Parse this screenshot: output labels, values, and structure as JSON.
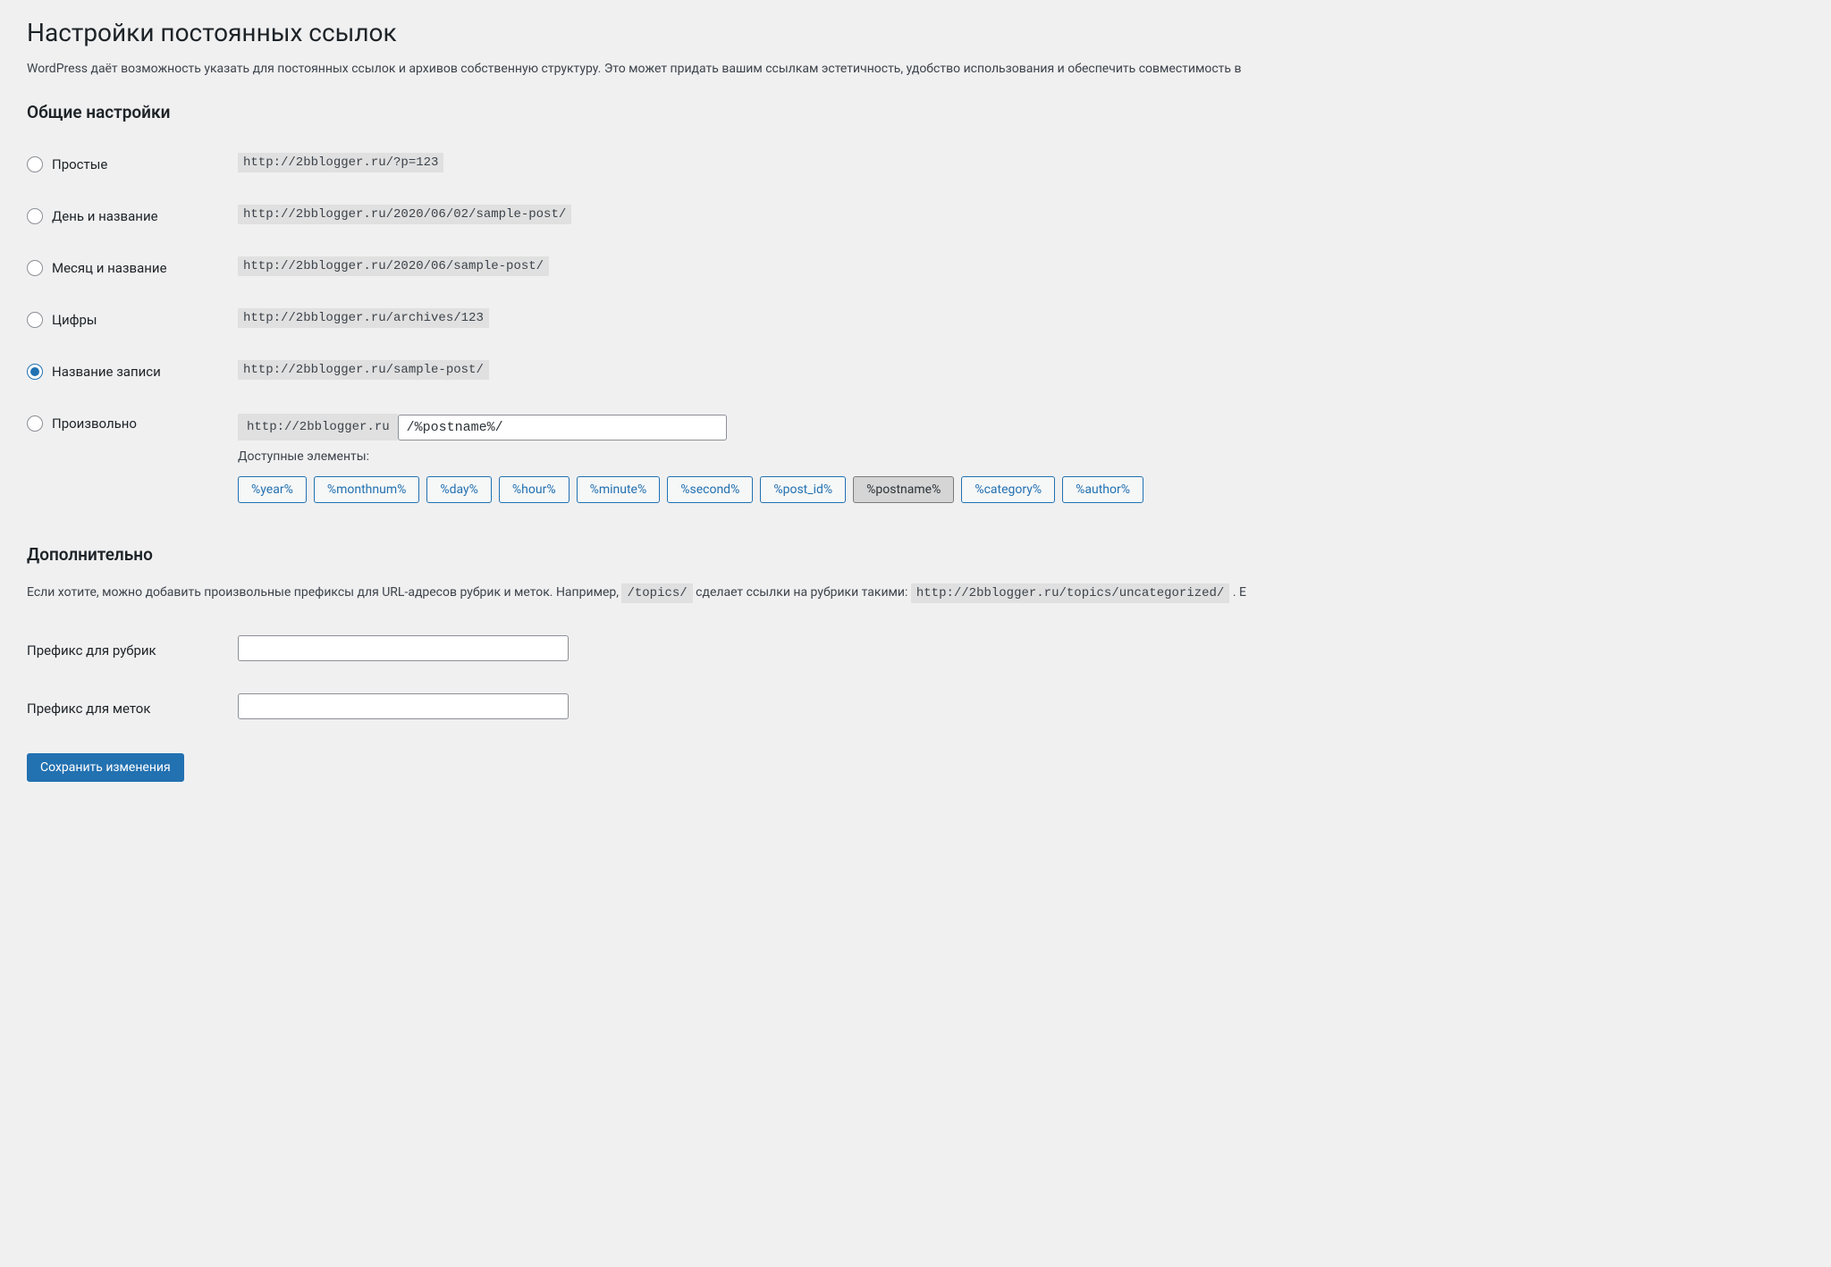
{
  "page_title": "Настройки постоянных ссылок",
  "description": "WordPress даёт возможность указать для постоянных ссылок и архивов собственную структуру. Это может придать вашим ссылкам эстетичность, удобство использования и обеспечить совместимость в",
  "common_settings_heading": "Общие настройки",
  "permalink_options": [
    {
      "label": "Простые",
      "example": "http://2bblogger.ru/?p=123",
      "checked": false
    },
    {
      "label": "День и название",
      "example": "http://2bblogger.ru/2020/06/02/sample-post/",
      "checked": false
    },
    {
      "label": "Месяц и название",
      "example": "http://2bblogger.ru/2020/06/sample-post/",
      "checked": false
    },
    {
      "label": "Цифры",
      "example": "http://2bblogger.ru/archives/123",
      "checked": false
    },
    {
      "label": "Название записи",
      "example": "http://2bblogger.ru/sample-post/",
      "checked": true
    },
    {
      "label": "Произвольно",
      "url_prefix": "http://2bblogger.ru",
      "checked": false
    }
  ],
  "custom_structure_value": "/%postname%/",
  "available_tags_label": "Доступные элементы:",
  "structure_tags": [
    {
      "label": "%year%",
      "active": false
    },
    {
      "label": "%monthnum%",
      "active": false
    },
    {
      "label": "%day%",
      "active": false
    },
    {
      "label": "%hour%",
      "active": false
    },
    {
      "label": "%minute%",
      "active": false
    },
    {
      "label": "%second%",
      "active": false
    },
    {
      "label": "%post_id%",
      "active": false
    },
    {
      "label": "%postname%",
      "active": true
    },
    {
      "label": "%category%",
      "active": false
    },
    {
      "label": "%author%",
      "active": false
    }
  ],
  "optional": {
    "heading": "Дополнительно",
    "description_before": "Если хотите, можно добавить произвольные префиксы для URL-адресов рубрик и меток. Например, ",
    "topics_code": "/topics/",
    "description_middle": " сделает ссылки на рубрики такими: ",
    "example_url": "http://2bblogger.ru/topics/uncategorized/",
    "description_after": " . Е",
    "category_base_label": "Префикс для рубрик",
    "category_base_value": "",
    "tag_base_label": "Префикс для меток",
    "tag_base_value": ""
  },
  "submit_label": "Сохранить изменения"
}
